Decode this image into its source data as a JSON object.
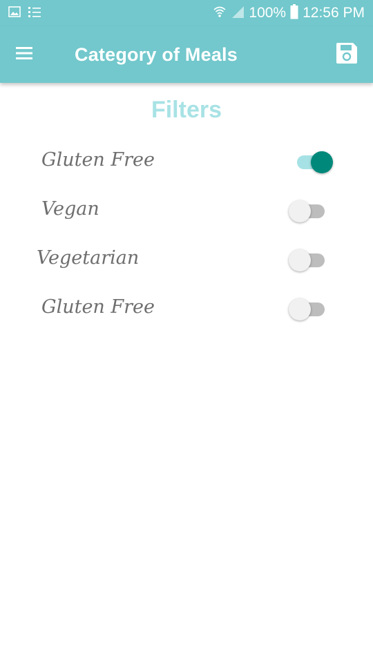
{
  "status_bar": {
    "battery": "100%",
    "time": "12:56 PM",
    "icons": [
      "image-notification-icon",
      "list-notification-icon",
      "wifi-icon",
      "cell-signal-icon",
      "battery-icon"
    ]
  },
  "app_bar": {
    "title": "Category of Meals",
    "menu_icon": "hamburger-menu-icon",
    "save_icon": "save-icon",
    "color": "#72c8cc"
  },
  "content": {
    "heading": "Filters",
    "heading_color": "#a8e2e5",
    "filters": [
      {
        "label": "Gluten Free",
        "enabled": true
      },
      {
        "label": "Vegan",
        "enabled": false
      },
      {
        "label": "Vegetarian",
        "enabled": false
      },
      {
        "label": "Gluten Free",
        "enabled": false
      }
    ],
    "switch_on_color": "#00897b"
  }
}
